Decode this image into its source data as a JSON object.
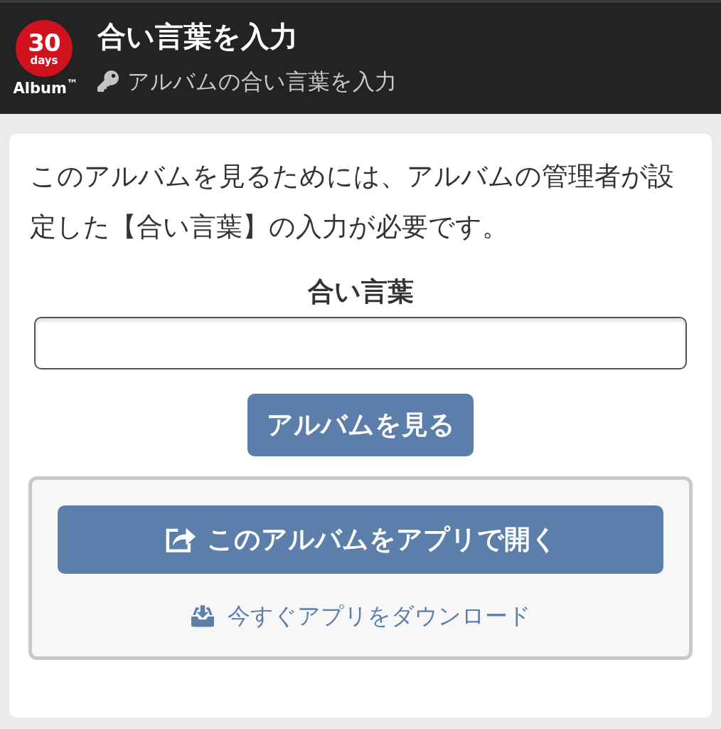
{
  "header": {
    "logo": {
      "number": "30",
      "unit": "days",
      "name": "Album$^{™}$"
    },
    "title": "合い言葉を入力",
    "subtitle": "アルバムの合い言葉を入力"
  },
  "intro": "このアルバムを見るためには、アルバムの管理者が設定した【合い言葉】の入力が必要です。",
  "passphrase": {
    "label": "合い言葉"
  },
  "submit_button": "アルバムを見る",
  "app_box": {
    "open_button": "このアルバムをアプリで開く",
    "download_link": "今すぐアプリをダウンロード"
  }
}
